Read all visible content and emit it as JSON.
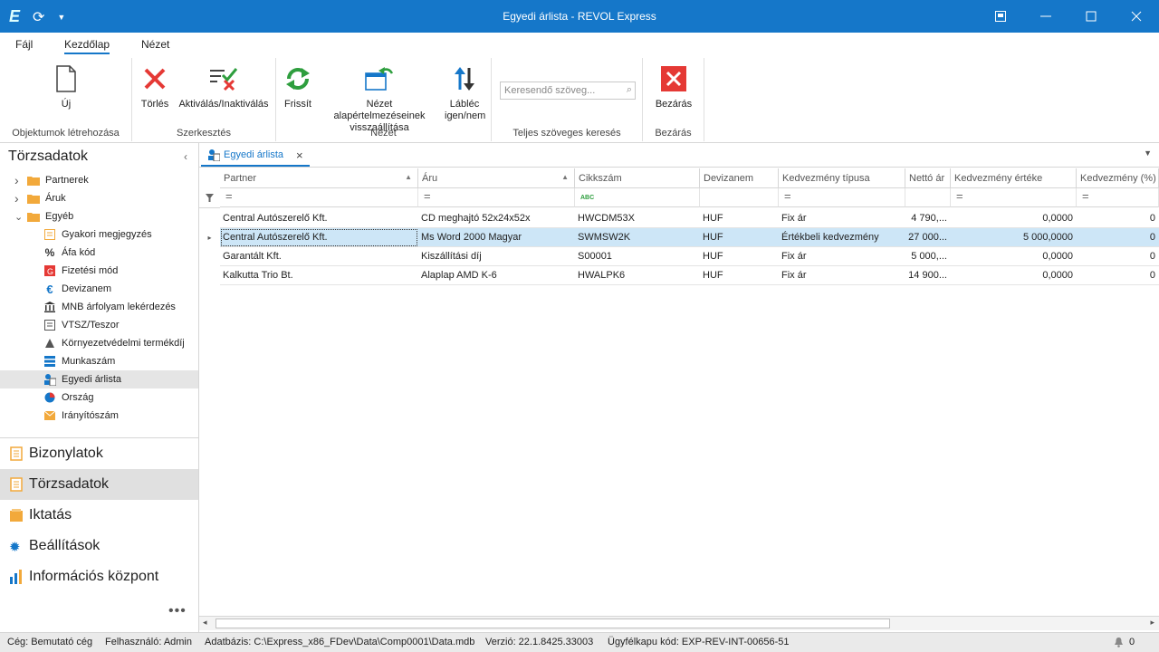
{
  "window": {
    "title": "Egyedi árlista - REVOL Express"
  },
  "menu": {
    "items": [
      "Fájl",
      "Kezdőlap",
      "Nézet"
    ],
    "active": "Kezdőlap"
  },
  "ribbon": {
    "groups": [
      {
        "title": "Objektumok létrehozása"
      },
      {
        "title": "Szerkesztés"
      },
      {
        "title": "Nézet"
      },
      {
        "title": "Teljes szöveges keresés"
      },
      {
        "title": "Bezárás"
      }
    ],
    "buttons": {
      "new": "Új",
      "delete": "Törlés",
      "activate": "Aktiválás/Inaktiválás",
      "refresh": "Frissít",
      "reset_view": "Nézet alapértelmezéseinek visszaállítása",
      "footer": "Lábléc igen/nem",
      "close": "Bezárás"
    },
    "search_placeholder": "Keresendő szöveg..."
  },
  "sidebar": {
    "title": "Törzsadatok",
    "tree": [
      {
        "label": "Partnerek",
        "level": 0,
        "expander": "›",
        "icon": "folder-icon"
      },
      {
        "label": "Áruk",
        "level": 0,
        "expander": "›",
        "icon": "folder-icon"
      },
      {
        "label": "Egyéb",
        "level": 0,
        "expander": "⌄",
        "icon": "folder-icon"
      },
      {
        "label": "Gyakori megjegyzés",
        "level": 1,
        "icon": "note-icon"
      },
      {
        "label": "Áfa kód",
        "level": 1,
        "icon": "percent-icon"
      },
      {
        "label": "Fizetési mód",
        "level": 1,
        "icon": "payment-icon"
      },
      {
        "label": "Devizanem",
        "level": 1,
        "icon": "euro-icon"
      },
      {
        "label": "MNB árfolyam lekérdezés",
        "level": 1,
        "icon": "bank-icon"
      },
      {
        "label": "VTSZ/Teszor",
        "level": 1,
        "icon": "calendar-icon"
      },
      {
        "label": "Környezetvédelmi termékdíj",
        "level": 1,
        "icon": "triangle-icon"
      },
      {
        "label": "Munkaszám",
        "level": 1,
        "icon": "list-icon"
      },
      {
        "label": "Egyedi árlista",
        "level": 1,
        "icon": "pricelist-icon",
        "selected": true
      },
      {
        "label": "Ország",
        "level": 1,
        "icon": "globe-icon"
      },
      {
        "label": "Irányítószám",
        "level": 1,
        "icon": "envelope-icon"
      }
    ],
    "nav": [
      {
        "label": "Bizonylatok",
        "icon": "document-icon"
      },
      {
        "label": "Törzsadatok",
        "icon": "tree-icon",
        "selected": true
      },
      {
        "label": "Iktatás",
        "icon": "archive-icon"
      },
      {
        "label": "Beállítások",
        "icon": "gear-icon"
      },
      {
        "label": "Információs központ",
        "icon": "chart-icon"
      }
    ],
    "more": "•••"
  },
  "tab": {
    "label": "Egyedi árlista",
    "close": "×"
  },
  "grid": {
    "columns": [
      "Partner",
      "Áru",
      "Cikkszám",
      "Devizanem",
      "Kedvezmény típusa",
      "Nettó ár",
      "Kedvezmény értéke",
      "Kedvezmény (%)"
    ],
    "filter_symbols": [
      "=",
      "=",
      "ABC",
      "",
      "=",
      "",
      "=",
      "="
    ],
    "rows": [
      [
        "Central Autószerelő Kft.",
        "CD meghajtó 52x24x52x",
        "HWCDM53X",
        "HUF",
        "Fix ár",
        "4 790,...",
        "0,0000",
        "0"
      ],
      [
        "Central Autószerelő Kft.",
        "Ms Word 2000 Magyar",
        "SWMSW2K",
        "HUF",
        "Értékbeli kedvezmény",
        "27 000...",
        "5 000,0000",
        "0"
      ],
      [
        "Garantált Kft.",
        "Kiszállítási díj",
        "S00001",
        "HUF",
        "Fix ár",
        "5 000,...",
        "0,0000",
        "0"
      ],
      [
        "Kalkutta Trio Bt.",
        "Alaplap AMD K-6",
        "HWALPK6",
        "HUF",
        "Fix ár",
        "14 900...",
        "0,0000",
        "0"
      ]
    ],
    "selected_row": 1
  },
  "status": {
    "company": "Cég: Bemutató cég",
    "user": "Felhasználó: Admin",
    "database": "Adatbázis: C:\\Express_x86_FDev\\Data\\Comp0001\\Data.mdb",
    "version": "Verzió: 22.1.8425.33003",
    "gateway": "Ügyfélkapu kód: EXP-REV-INT-00656-51",
    "notifications": "0"
  },
  "colors": {
    "accent": "#1577c9",
    "selection": "#cde6f7",
    "red": "#e53935",
    "green": "#2e9e3e"
  }
}
